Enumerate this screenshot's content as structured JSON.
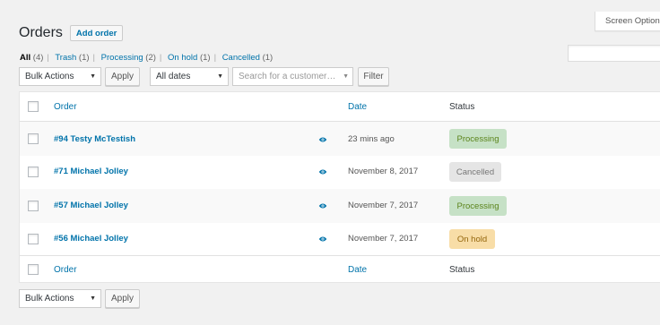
{
  "header": {
    "screen_options": "Screen Options",
    "title": "Orders",
    "add_order": "Add order"
  },
  "filters": {
    "views": [
      {
        "label": "All",
        "count": "(4)",
        "current": true
      },
      {
        "label": "Trash",
        "count": "(1)",
        "current": false
      },
      {
        "label": "Processing",
        "count": "(2)",
        "current": false
      },
      {
        "label": "On hold",
        "count": "(1)",
        "current": false
      },
      {
        "label": "Cancelled",
        "count": "(1)",
        "current": false
      }
    ],
    "separator": "|",
    "bulk_actions": "Bulk Actions",
    "apply": "Apply",
    "all_dates": "All dates",
    "customer_placeholder": "Search for a customer…",
    "filter": "Filter"
  },
  "table": {
    "columns": {
      "order": "Order",
      "date": "Date",
      "status": "Status"
    },
    "rows": [
      {
        "order": "#94 Testy McTestish",
        "date": "23 mins ago",
        "status": "Processing",
        "status_key": "processing"
      },
      {
        "order": "#71 Michael Jolley",
        "date": "November 8, 2017",
        "status": "Cancelled",
        "status_key": "cancelled"
      },
      {
        "order": "#57 Michael Jolley",
        "date": "November 7, 2017",
        "status": "Processing",
        "status_key": "processing"
      },
      {
        "order": "#56 Michael Jolley",
        "date": "November 7, 2017",
        "status": "On hold",
        "status_key": "on-hold"
      }
    ]
  },
  "bottom": {
    "bulk_actions": "Bulk Actions",
    "apply": "Apply"
  },
  "colors": {
    "link": "#0073aa",
    "processing_bg": "#c6e1c6",
    "processing_fg": "#5b841b",
    "cancelled_bg": "#e5e5e5",
    "cancelled_fg": "#777777",
    "on_hold_bg": "#f8dda7",
    "on_hold_fg": "#94660c"
  },
  "icons": {
    "row_preview": "eye-icon",
    "dropdown": "chevron-down-icon"
  }
}
